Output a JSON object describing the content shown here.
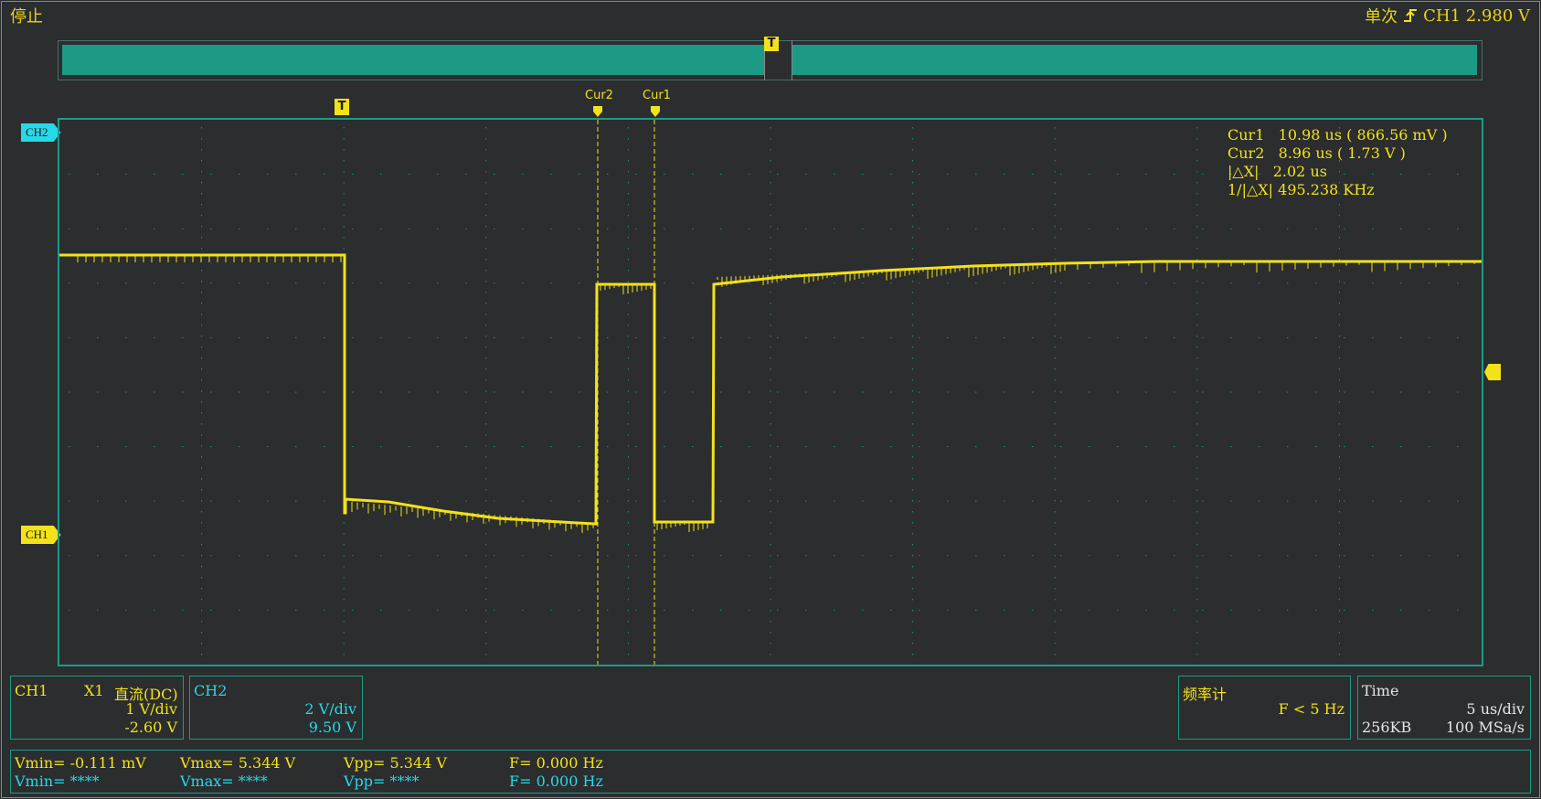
{
  "status": {
    "run_state": "停止",
    "mode": "单次",
    "trigger_source": "CH1 2.980 V"
  },
  "markers": {
    "trigger_label": "T",
    "cur1_label": "Cur1",
    "cur2_label": "Cur2"
  },
  "channel_tags": {
    "ch1": "CH1",
    "ch2": "CH2"
  },
  "cursor_readout": {
    "cur1": "Cur1   10.98 us ( 866.56 mV )",
    "cur2": "Cur2   8.96 us ( 1.73 V )",
    "dx": "|△X|   2.02 us",
    "inv_dx": "1/|△X| 495.238 KHz"
  },
  "ch1_panel": {
    "name": "CH1",
    "probe": "X1",
    "coupling": "直流(DC)",
    "scale": "1 V/div",
    "offset": "-2.60 V"
  },
  "ch2_panel": {
    "name": "CH2",
    "scale": "2 V/div",
    "offset": "9.50 V"
  },
  "freq_panel": {
    "title": "频率计",
    "value": "F < 5 Hz"
  },
  "time_panel": {
    "title": "Time",
    "scale": "5 us/div",
    "memory": "256KB",
    "rate": "100 MSa/s"
  },
  "measurements": {
    "ch1": {
      "vmin": "Vmin= -0.111 mV",
      "vmax": "Vmax= 5.344 V",
      "vpp": "Vpp= 5.344 V",
      "f": "F= 0.000 Hz"
    },
    "ch2": {
      "vmin": "Vmin= ****",
      "vmax": "Vmax= ****",
      "vpp": "Vpp= ****",
      "f": "F= 0.000 Hz"
    }
  },
  "colors": {
    "ch1": "#f2e21b",
    "ch2": "#27d8e9",
    "grid": "#1d9a86",
    "background": "#2b2d2e"
  }
}
